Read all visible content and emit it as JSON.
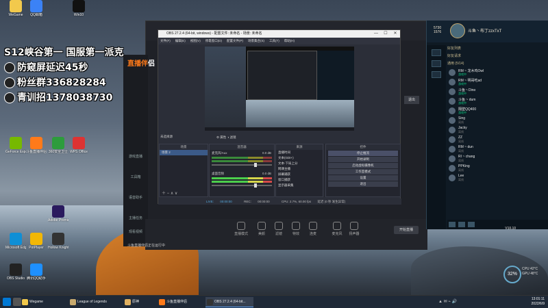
{
  "overlay": {
    "line1": "S12峡谷第一 国服第一派克",
    "line2": "防窥屏延迟45秒",
    "line3": "粉丝群336828284",
    "line4": "青训招1378038730"
  },
  "desktop_icons": [
    {
      "label": "WeGame",
      "color": "#f2c94c"
    },
    {
      "label": "QQ邮箱",
      "color": "#3b82f6"
    },
    {
      "label": "Win10",
      "color": "#111"
    },
    {
      "label": "GeForce Experience",
      "color": "#76b900"
    },
    {
      "label": "斗鱼直播伴侣",
      "color": "#ff7a1a"
    },
    {
      "label": "360安全卫士",
      "color": "#2d9c3c"
    },
    {
      "label": "WPS Office",
      "color": "#d33"
    },
    {
      "label": "Adobe Premiere",
      "color": "#2a1a5e"
    },
    {
      "label": "Microsoft Edge",
      "color": "#0f8fd6"
    },
    {
      "label": "PotPlayer",
      "color": "#f2b705"
    },
    {
      "label": "Hollow Knight",
      "color": "#333"
    },
    {
      "label": "OBS Studio",
      "color": "#222"
    },
    {
      "label": "腾讯QQ助手",
      "color": "#1e90ff"
    }
  ],
  "douyu": {
    "logo_a": "直播伴",
    "logo_b": "侣",
    "side_items": [
      "游戏直播",
      "工具箱",
      "语音助手",
      "主播任务",
      "观看视频"
    ],
    "tab": "退出",
    "bottom_items": [
      "直播模式",
      "美颜",
      "滤镜",
      "特效",
      "连麦",
      "麦克风",
      "扬声器"
    ],
    "start_button": "开始直播",
    "notice": "斗鱼直播伴侣正在运行中"
  },
  "lol": {
    "coins_be": "5730",
    "coins_rp": "1576",
    "player_name": "斗鱼丶布丁zzxTxT",
    "friends_header": "好友列表",
    "requests": "好友请求",
    "group": "通用 (5/14)",
    "friends": [
      {
        "name": "RM ~ 龙木鸡Owl",
        "status": "游戏中",
        "online": true
      },
      {
        "name": "RM ~ 明哥吃ad",
        "status": "游戏中",
        "online": true
      },
      {
        "name": "斗鱼丶Dino",
        "status": "游戏中",
        "online": true
      },
      {
        "name": "斗鱼 ~ dum",
        "status": "游戏中",
        "online": true
      },
      {
        "name": "隔壁QQ400",
        "status": "游戏中",
        "online": true
      },
      {
        "name": "Sing",
        "status": "离线",
        "online": false
      },
      {
        "name": "Jacky",
        "status": "离线",
        "online": false
      },
      {
        "name": "ZZ",
        "status": "离线",
        "online": false
      },
      {
        "name": "RM ~ dun",
        "status": "离线",
        "online": false
      },
      {
        "name": "RI ~ chang",
        "status": "离线",
        "online": false
      },
      {
        "name": "PPKing",
        "status": "离线",
        "online": false
      },
      {
        "name": "Lee",
        "status": "离线",
        "online": false
      }
    ],
    "version": "V10.10"
  },
  "obs": {
    "title": "OBS 27.2.4 (64-bit, windows) - 配置文件: 未命名 - 场景: 未命名",
    "menu": [
      "文件(F)",
      "编辑(E)",
      "视图(V)",
      "停靠窗口(D)",
      "配置文件(P)",
      "场景集合(S)",
      "工具(T)",
      "帮助(H)"
    ],
    "source_bar_label": "未选择源",
    "props_label": "属性",
    "filter_label": "滤镜",
    "scenes_header": "场景",
    "scenes": [
      "场景 2"
    ],
    "sources_header": "来源",
    "sources": [
      "直播时间",
      "文本(GDI+)",
      "文本-下局上分",
      "网课主播",
      "屏幕捕获",
      "窗口捕获",
      "显示器采集"
    ],
    "mixer_header": "混音器",
    "mixer": [
      {
        "name": "麦克风/Aux",
        "db": "0.0 dB"
      },
      {
        "name": "桌面音频",
        "db": "0.0 dB"
      }
    ],
    "transitions_header": "转场特效",
    "controls_header": "控件",
    "controls": [
      "停止推流",
      "开始录制",
      "启动虚拟摄像机",
      "工作室模式",
      "设置",
      "退出"
    ],
    "status": {
      "live_label": "LIVE:",
      "live_time": "00:00:00",
      "rec_label": "REC:",
      "rec_time": "00:00:00",
      "cpu": "CPU: 2.7%, 60.00 fps",
      "extra": "延迟 (0 秒 发生异常)"
    }
  },
  "taskbar": {
    "items": [
      {
        "label": "Wegame",
        "color": "#f2c94c"
      },
      {
        "label": "League of Legends",
        "color": "#c8aa6e"
      },
      {
        "label": "原神",
        "color": "#e0b060"
      },
      {
        "label": "斗鱼直播伴侣",
        "color": "#ff7a1a"
      },
      {
        "label": "OBS 27.2.4 (64-bit...",
        "color": "#333"
      }
    ],
    "time": "13:01:11",
    "date": "2022/6/9"
  },
  "cpu_widget": {
    "percent": "32%",
    "label_a": "CPU 42°C",
    "label_b": "GPU 48°C"
  }
}
